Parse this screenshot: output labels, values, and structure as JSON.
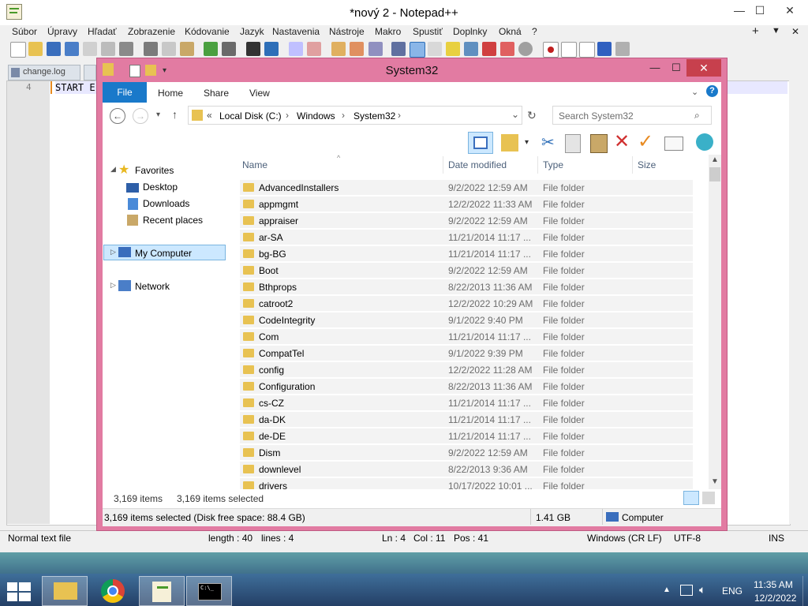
{
  "notepad": {
    "title": "*nový 2 - Notepad++",
    "controls": {
      "minimize": "—",
      "maximize": "☐",
      "close": "✕"
    },
    "menu": [
      "Súbor",
      "Úpravy",
      "Hľadať",
      "Zobrazenie",
      "Kódovanie",
      "Jazyk",
      "Nastavenia",
      "Nástroje",
      "Makro",
      "Spustiť",
      "Doplnky",
      "Okná",
      "?"
    ],
    "menu_right": {
      "plus": "+",
      "down": "▼",
      "close": "✕"
    },
    "tabs": [
      "change.log"
    ],
    "editor": {
      "line_number": "4",
      "line_text": "START E"
    },
    "status": {
      "type": "Normal text file",
      "length": "length : 40",
      "lines": "lines : 4",
      "ln": "Ln : 4",
      "col": "Col : 11",
      "pos": "Pos : 41",
      "eol": "Windows (CR LF)",
      "encoding": "UTF-8",
      "ins": "INS"
    }
  },
  "explorer": {
    "title": "System32",
    "controls": {
      "minimize": "—",
      "maximize": "☐",
      "close": "✕"
    },
    "ribbon": {
      "file": "File",
      "home": "Home",
      "share": "Share",
      "view": "View"
    },
    "address": {
      "prefix": "«",
      "parts": [
        "Local Disk (C:)",
        "Windows",
        "System32"
      ],
      "sep": "›"
    },
    "search_placeholder": "Search System32",
    "nav": {
      "favorites": "Favorites",
      "desktop": "Desktop",
      "downloads": "Downloads",
      "recent": "Recent places",
      "my_computer": "My Computer",
      "network": "Network"
    },
    "columns": {
      "name": "Name",
      "date": "Date modified",
      "type": "Type",
      "size": "Size"
    },
    "rows": [
      {
        "name": "AdvancedInstallers",
        "date": "9/2/2022 12:59 AM",
        "type": "File folder"
      },
      {
        "name": "appmgmt",
        "date": "12/2/2022 11:33 AM",
        "type": "File folder"
      },
      {
        "name": "appraiser",
        "date": "9/2/2022 12:59 AM",
        "type": "File folder"
      },
      {
        "name": "ar-SA",
        "date": "11/21/2014 11:17 ...",
        "type": "File folder"
      },
      {
        "name": "bg-BG",
        "date": "11/21/2014 11:17 ...",
        "type": "File folder"
      },
      {
        "name": "Boot",
        "date": "9/2/2022 12:59 AM",
        "type": "File folder"
      },
      {
        "name": "Bthprops",
        "date": "8/22/2013 11:36 AM",
        "type": "File folder"
      },
      {
        "name": "catroot2",
        "date": "12/2/2022 10:29 AM",
        "type": "File folder"
      },
      {
        "name": "CodeIntegrity",
        "date": "9/1/2022 9:40 PM",
        "type": "File folder"
      },
      {
        "name": "Com",
        "date": "11/21/2014 11:17 ...",
        "type": "File folder"
      },
      {
        "name": "CompatTel",
        "date": "9/1/2022 9:39 PM",
        "type": "File folder"
      },
      {
        "name": "config",
        "date": "12/2/2022 11:28 AM",
        "type": "File folder"
      },
      {
        "name": "Configuration",
        "date": "8/22/2013 11:36 AM",
        "type": "File folder"
      },
      {
        "name": "cs-CZ",
        "date": "11/21/2014 11:17 ...",
        "type": "File folder"
      },
      {
        "name": "da-DK",
        "date": "11/21/2014 11:17 ...",
        "type": "File folder"
      },
      {
        "name": "de-DE",
        "date": "11/21/2014 11:17 ...",
        "type": "File folder"
      },
      {
        "name": "Dism",
        "date": "9/2/2022 12:59 AM",
        "type": "File folder"
      },
      {
        "name": "downlevel",
        "date": "8/22/2013 9:36 AM",
        "type": "File folder"
      },
      {
        "name": "drivers",
        "date": "10/17/2022 10:01 ...",
        "type": "File folder"
      }
    ],
    "status": {
      "items": "3,169 items",
      "selected": "3,169 items selected"
    },
    "details": {
      "summary": "3,169 items selected (Disk free space: 88.4 GB)",
      "size": "1.41 GB",
      "location": "Computer"
    }
  },
  "taskbar": {
    "lang": "ENG",
    "time": "11:35 AM",
    "date": "12/2/2022",
    "cmd_label": "C:\\_"
  },
  "colors": {
    "explorer_frame": "#e27ba2",
    "file_tab": "#1979ca",
    "selection": "#cce8ff"
  }
}
